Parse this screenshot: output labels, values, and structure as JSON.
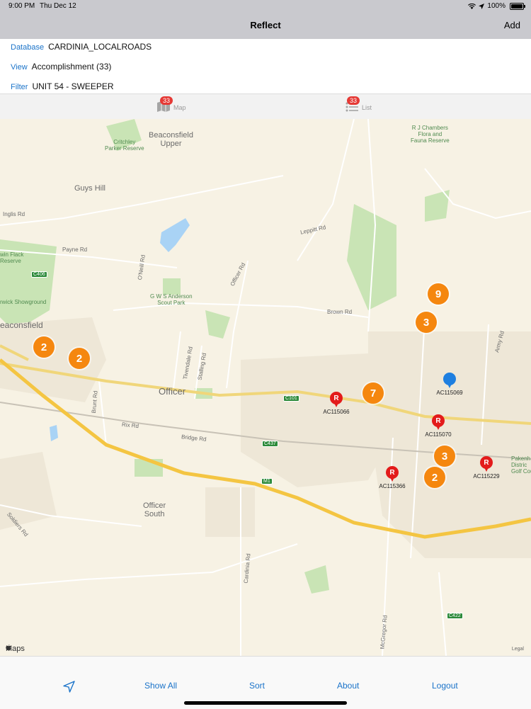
{
  "status": {
    "time": "9:00 PM",
    "date": "Thu Dec 12",
    "battery": "100%"
  },
  "nav": {
    "title": "Reflect",
    "add_label": "Add"
  },
  "info": {
    "database_label": "Database",
    "database_value": "CARDINIA_LOCALROADS",
    "view_label": "View",
    "view_value": "Accomplishment (33)",
    "filter_label": "Filter",
    "filter_value": "UNIT 54 - SWEEPER"
  },
  "tabs": {
    "map": {
      "label": "Map",
      "badge": "33"
    },
    "list": {
      "label": "List",
      "badge": "33"
    }
  },
  "map": {
    "place_labels": {
      "beaconsfield_upper": "Beaconsfield\nUpper",
      "guys_hill": "Guys Hill",
      "beaconsfield": "eaconsfield",
      "officer": "Officer",
      "officer_south": "Officer\nSouth",
      "critchley": "Critchley\nParker Reserve",
      "rj_chambers": "R J Chambers\nFlora and\nFauna Reserve",
      "gws_anderson": "G W S Anderson\nScout Park",
      "win_flack": "win Flack\nReserve",
      "rwick": "rwick Showground",
      "pakenham": "Pakenh\nDistric\nGolf Cou"
    },
    "road_labels": {
      "inglis": "Inglis Rd",
      "payne": "Payne Rd",
      "brown": "Brown Rd",
      "leppitt": "Leppitt Rd",
      "officer_rd": "Officer Rd",
      "tivendale": "Tivendale Rd",
      "stalling": "Stalling Rd",
      "rix": "Rix Rd",
      "bridge": "Bridge Rd",
      "cardinia": "Cardinia Rd",
      "mcgregor": "McGregor Rd",
      "army": "Army Rd",
      "brunt": "Brunt Rd",
      "soldiers": "Soldiers Rd",
      "o_neill": "O'Neill Rd"
    },
    "shields": {
      "c406": "C406",
      "c101": "C101",
      "c437": "C437",
      "m1": "M1",
      "c422": "C422"
    },
    "clusters": [
      "9",
      "3",
      "2",
      "2",
      "7",
      "3",
      "2"
    ],
    "pins": [
      {
        "code": "AC115066",
        "letter": "R"
      },
      {
        "code": "AC115070",
        "letter": "R"
      },
      {
        "code": "AC115366",
        "letter": "R"
      },
      {
        "code": "AC115229",
        "letter": "R"
      },
      {
        "code": "AC115069",
        "letter": ""
      }
    ],
    "attribution": "Maps",
    "legal": "Legal"
  },
  "bottom": {
    "show_all": "Show All",
    "sort": "Sort",
    "about": "About",
    "logout": "Logout"
  }
}
